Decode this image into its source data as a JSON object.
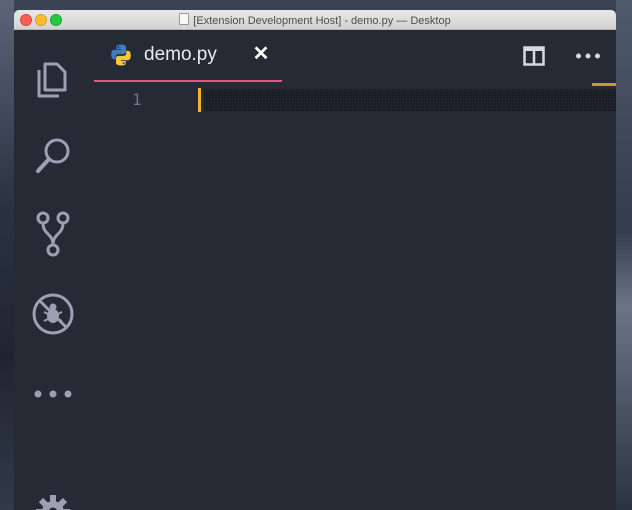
{
  "window": {
    "title": "[Extension Development Host] - demo.py — Desktop",
    "buttons": [
      "close",
      "minimize",
      "zoom"
    ]
  },
  "activity_bar": {
    "items": [
      {
        "icon": "files-icon"
      },
      {
        "icon": "search-icon"
      },
      {
        "icon": "source-control-icon"
      },
      {
        "icon": "debug-icon"
      },
      {
        "icon": "more-icon"
      },
      {
        "icon": "gear-icon"
      }
    ]
  },
  "editor": {
    "tab": {
      "label": "demo.py",
      "icon": "python-icon",
      "close_glyph": "✕"
    },
    "actions": {
      "split_icon": "split-editor-icon",
      "more_glyph": "•••"
    },
    "lines": [
      {
        "number": "1",
        "content": ""
      }
    ]
  },
  "colors": {
    "background": "#262a35",
    "tab_underline": "#e0557d",
    "cursor": "#f0b429",
    "line_number": "#6b7388"
  }
}
